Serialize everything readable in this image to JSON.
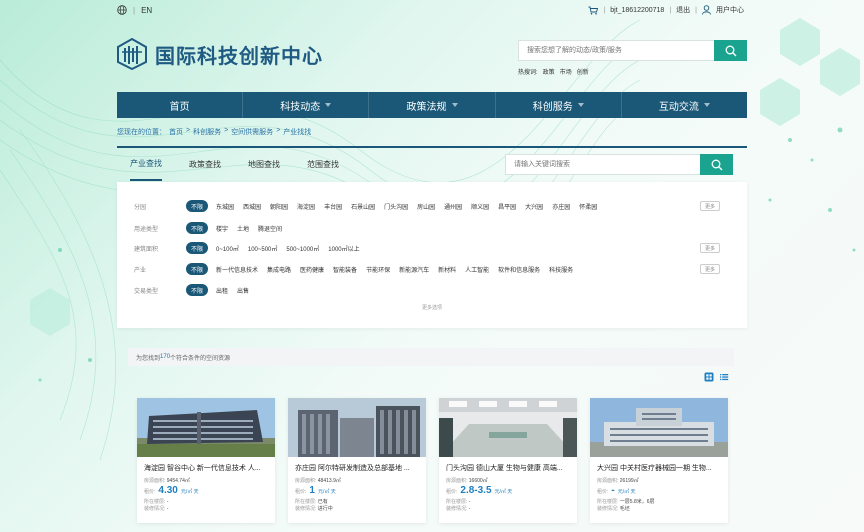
{
  "topbar": {
    "lang": "EN",
    "username": "bjt_18612200718",
    "logout": "退出",
    "user_center": "用户中心"
  },
  "header": {
    "site_title": "国际科技创新中心",
    "search_placeholder": "搜索您想了解的动态/政策/服务",
    "hot_label": "热搜词:",
    "hot_words": [
      "政策",
      "市场",
      "创新"
    ]
  },
  "nav": [
    "首页",
    "科技动态",
    "政策法规",
    "科创服务",
    "互动交流"
  ],
  "breadcrumb": {
    "prefix": "您现在的位置：",
    "items": [
      "首页",
      "科创服务",
      "空间供需服务",
      "产业找找"
    ]
  },
  "tabs": [
    "产业查找",
    "政策查找",
    "地图查找",
    "范围查找"
  ],
  "sub_search_placeholder": "请输入关键词搜索",
  "filters": {
    "all_label": "不限",
    "more_label": "更多",
    "more_filters": "更多选项",
    "rows": [
      {
        "label": "分园",
        "options": [
          "东城园",
          "西城园",
          "朝阳园",
          "海淀园",
          "丰台园",
          "石景山园",
          "门头沟园",
          "房山园",
          "通州园",
          "顺义园",
          "昌平园",
          "大兴园",
          "亦庄园",
          "怀柔园"
        ]
      },
      {
        "label": "用途类型",
        "options": [
          "楼宇",
          "土地",
          "腾退空间"
        ]
      },
      {
        "label": "建筑面积",
        "options": [
          "0~100㎡",
          "100~500㎡",
          "500~1000㎡",
          "1000㎡以上"
        ]
      },
      {
        "label": "产业",
        "options": [
          "新一代信息技术",
          "集成电路",
          "医药健康",
          "智能装备",
          "节能环保",
          "新能源汽车",
          "新材料",
          "人工智能",
          "软件和信息服务",
          "科技服务"
        ]
      },
      {
        "label": "交易类型",
        "options": [
          "出租",
          "出售"
        ]
      }
    ]
  },
  "results": {
    "prefix": "为您找到",
    "count": "170",
    "suffix": "个符合条件的空间资源"
  },
  "cards": [
    {
      "title": "海淀园 智谷中心 新一代信息技术 人...",
      "area_label": "房源面积:",
      "area": "9454.74㎡",
      "rent_label": "租价:",
      "price": "4.30",
      "unit": "元/㎡ 天",
      "floor_label": "所在楼层:",
      "floor": "-",
      "decor_label": "装修情况:",
      "decor": "-"
    },
    {
      "title": "亦庄园 阿尔特研发制造及总部基地 ...",
      "area_label": "房源面积:",
      "area": "48413.9㎡",
      "rent_label": "租价:",
      "price": "1",
      "unit": "元/㎡ 天",
      "floor_label": "所在楼层:",
      "floor": "已有",
      "decor_label": "装修情况:",
      "decor": "进行中"
    },
    {
      "title": "门头沟园 德山大厦 生物与健康 高端...",
      "area_label": "房源面积:",
      "area": "16600㎡",
      "rent_label": "租价:",
      "price": "2.8-3.5",
      "unit": "元/㎡ 天",
      "floor_label": "所在楼层:",
      "floor": "-",
      "decor_label": "装修情况:",
      "decor": "-"
    },
    {
      "title": "大兴园 中关村医疗器械园一期 生物...",
      "area_label": "房源面积:",
      "area": "26199㎡",
      "rent_label": "租价:",
      "price": "-",
      "unit": "元/㎡ 天",
      "floor_label": "所在楼层:",
      "floor": "一层5.8米，6层",
      "decor_label": "装修情况:",
      "decor": "毛坯"
    }
  ],
  "colors": {
    "primary": "#1b5878",
    "accent": "#1aa38e",
    "link": "#2a72a6"
  }
}
